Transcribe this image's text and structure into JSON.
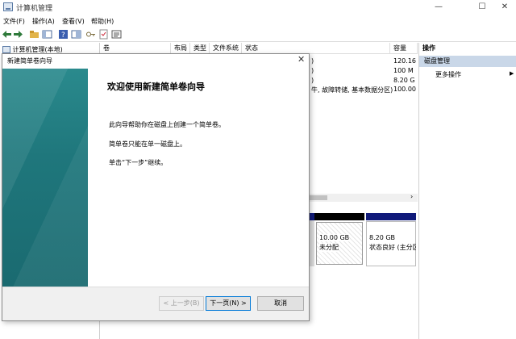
{
  "window": {
    "title": "计算机管理",
    "min": "—",
    "max": "☐",
    "close": "✕"
  },
  "menu": [
    "文件(F)",
    "操作(A)",
    "查看(V)",
    "帮助(H)"
  ],
  "tree": {
    "root": "计算机管理(本地)"
  },
  "table": {
    "headers": [
      "卷",
      "布局",
      "类型",
      "文件系统",
      "状态",
      "容量"
    ],
    "capacity": [
      "120.16",
      "100 M",
      "8.20 G",
      "100.00"
    ],
    "status_fragments": [
      ")",
      ")",
      ")",
      "牛, 故障转储, 基本数据分区)"
    ]
  },
  "operations": {
    "header": "操作",
    "section": "磁盘管理",
    "more": "更多操作",
    "arrow": "▶"
  },
  "disks": [
    {
      "size": "10.00 GB",
      "status": "未分配"
    },
    {
      "size": "8.20 GB",
      "status": "状态良好 (主分区"
    }
  ],
  "wizard": {
    "title": "新建简单卷向导",
    "close": "✕",
    "heading": "欢迎使用新建简单卷向导",
    "p1": "此向导帮助你在磁盘上创建一个简单卷。",
    "p2": "简单卷只能在单一磁盘上。",
    "p3": "单击“下一步”继续。",
    "back": "< 上一步(B)",
    "next": "下一页(N) >",
    "cancel": "取消"
  },
  "colors": {
    "disk_header": "#101a7a",
    "selection": "#c9d7e8",
    "banner": "#1f777c"
  }
}
